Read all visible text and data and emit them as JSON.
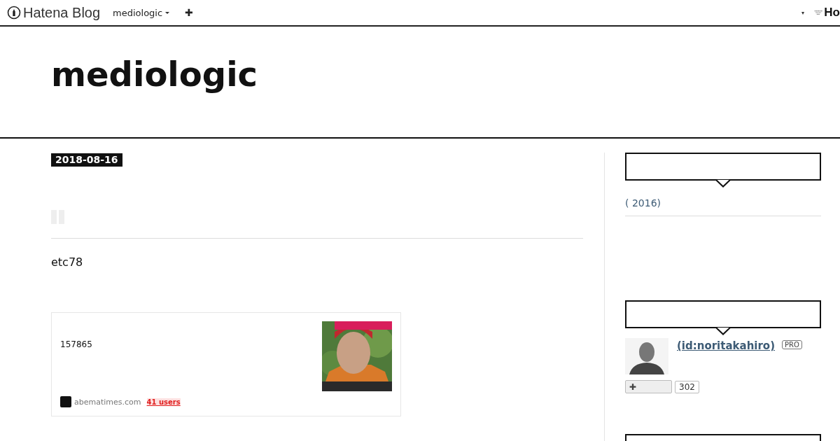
{
  "topbar": {
    "logo": "Hatena Blog",
    "blog_menu": "mediologic",
    "add_button": "✚",
    "right_dropdown": "▾",
    "right_text": "Ho"
  },
  "blog": {
    "title": "mediologic"
  },
  "entry": {
    "date": "2018-08-16",
    "body": "etc78",
    "embed": {
      "title": "157865",
      "site": "abematimes.com",
      "users": "41 users"
    }
  },
  "sidebar": {
    "archive": {
      "items": [
        {
          "label": "( 2016)"
        }
      ]
    },
    "profile": {
      "id_link": "(id:noritakahiro)",
      "badge": "PRO",
      "subscribe_icon": "✚",
      "count": "302"
    }
  }
}
